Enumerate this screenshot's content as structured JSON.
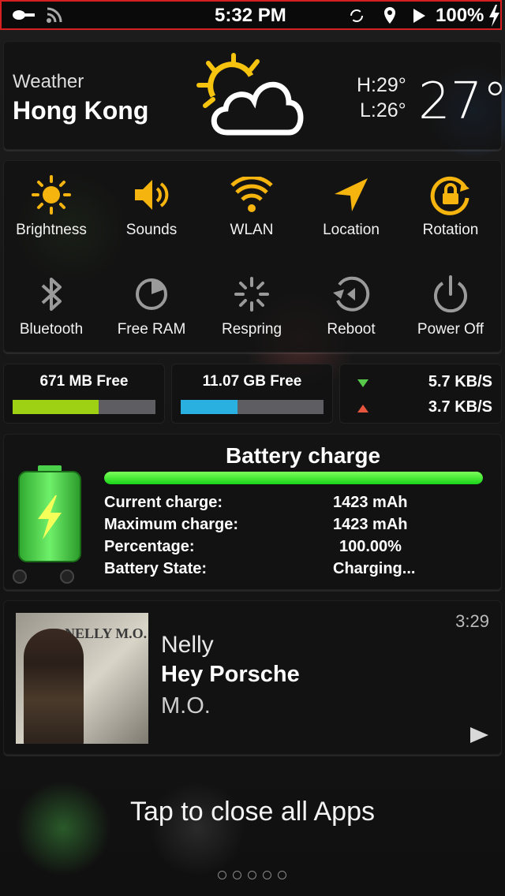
{
  "status_bar": {
    "time": "5:32 PM",
    "battery": "100%",
    "icons": [
      "spoon-icon",
      "wifi-icon",
      "sync-icon",
      "location-pin-icon",
      "play-icon",
      "bolt-icon"
    ]
  },
  "weather": {
    "label": "Weather",
    "city": "Hong Kong",
    "high": "H:29°",
    "low": "L:26°",
    "temperature": "27°",
    "icon": "sun-cloud-icon"
  },
  "toggles": {
    "row1": [
      {
        "label": "Brightness",
        "icon": "sun-icon"
      },
      {
        "label": "Sounds",
        "icon": "speaker-icon"
      },
      {
        "label": "WLAN",
        "icon": "wifi-icon"
      },
      {
        "label": "Location",
        "icon": "location-arrow-icon"
      },
      {
        "label": "Rotation",
        "icon": "rotation-lock-icon"
      }
    ],
    "row2": [
      {
        "label": "Bluetooth",
        "icon": "bluetooth-icon"
      },
      {
        "label": "Free RAM",
        "icon": "ram-pie-icon"
      },
      {
        "label": "Respring",
        "icon": "spinner-icon"
      },
      {
        "label": "Reboot",
        "icon": "reboot-icon"
      },
      {
        "label": "Power Off",
        "icon": "power-icon"
      }
    ]
  },
  "stats": {
    "ram": {
      "label": "671 MB Free",
      "fill_fraction": 0.6,
      "color": "#9ed014"
    },
    "storage": {
      "label": "11.07 GB Free",
      "fill_fraction": 0.4,
      "color": "#2ab0e0"
    },
    "network": {
      "down": "5.7 KB/S",
      "up": "3.7 KB/S"
    }
  },
  "battery": {
    "title": "Battery charge",
    "fill_fraction": 1.0,
    "rows": [
      {
        "label": "Current charge:",
        "value": "1423 mAh"
      },
      {
        "label": "Maximum charge:",
        "value": "1423 mAh"
      },
      {
        "label": "Percentage:",
        "value": "100.00%"
      },
      {
        "label": "Battery State:",
        "value": "Charging..."
      }
    ]
  },
  "music": {
    "time": "3:29",
    "artist": "Nelly",
    "song": "Hey Porsche",
    "album": "M.O.",
    "cover_text": "NELLY M.O."
  },
  "close_apps": "Tap to close all Apps"
}
